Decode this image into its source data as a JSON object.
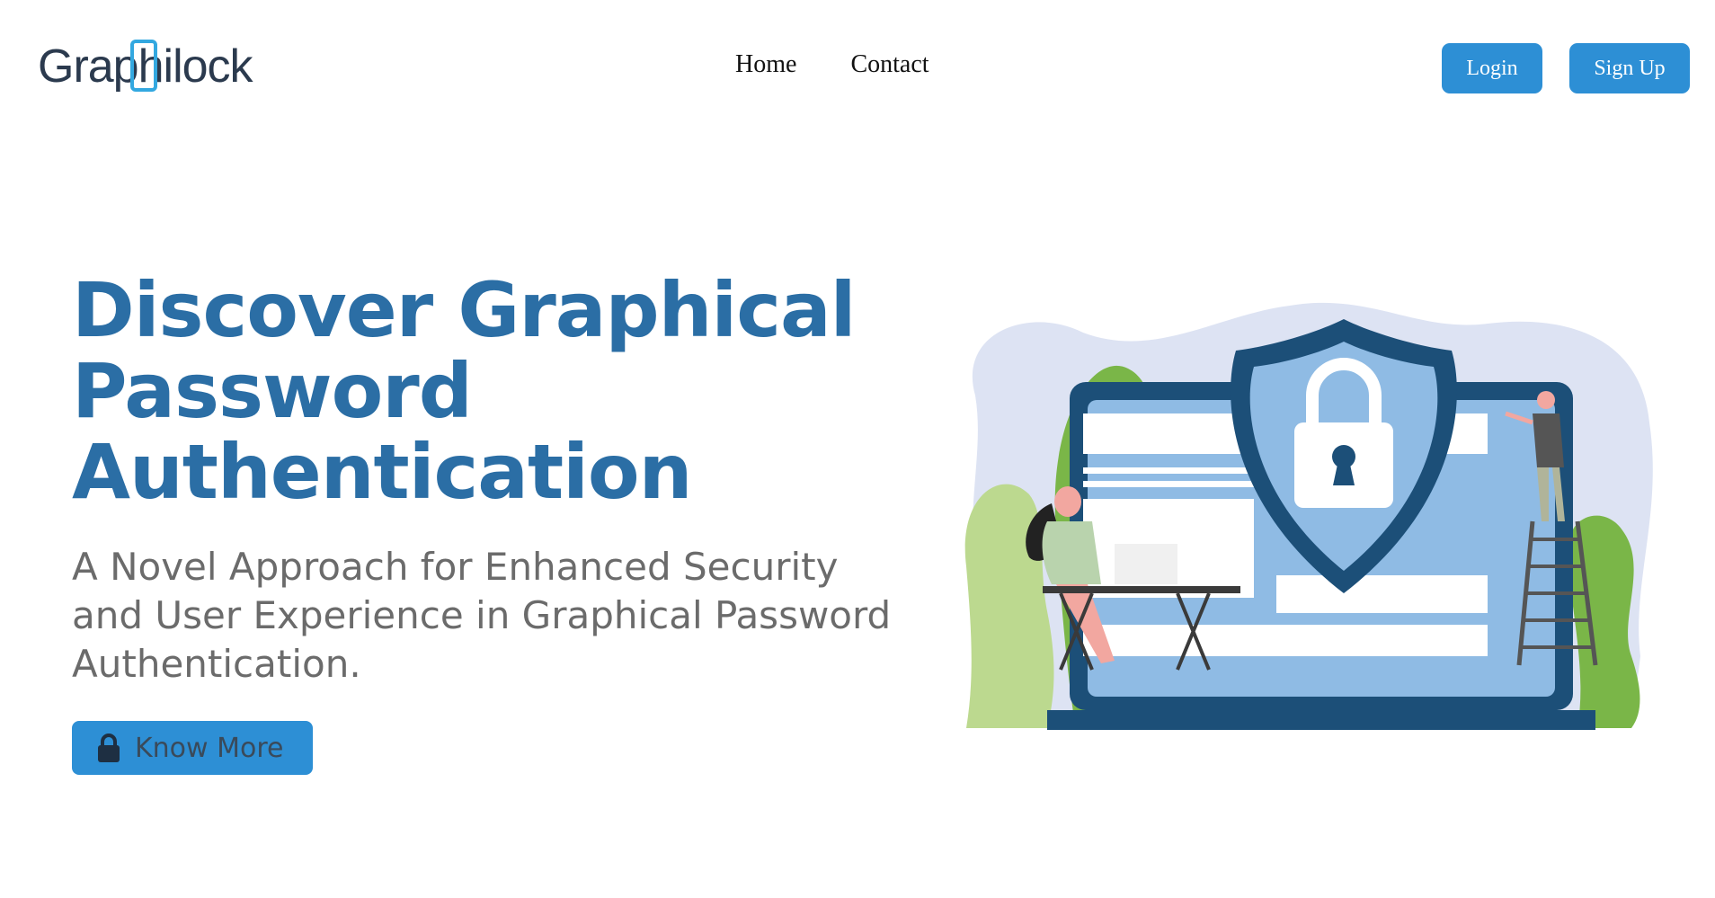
{
  "brand": {
    "logo_text": "Graphilock"
  },
  "nav": {
    "home": "Home",
    "contact": "Contact"
  },
  "auth": {
    "login": "Login",
    "signup": "Sign Up"
  },
  "hero": {
    "title": "Discover Graphical Password Authentication",
    "subtitle": "A Novel Approach for Enhanced Security and User Experience in Graphical Password Authentication.",
    "cta": "Know More"
  },
  "colors": {
    "primary": "#2d8fd5",
    "heading": "#2b6ea5",
    "subtitle": "#6b6b6b",
    "logo_accent": "#33a8e0",
    "shield_dark": "#1c4f78"
  },
  "icons": {
    "cta_icon": "lock-icon"
  }
}
